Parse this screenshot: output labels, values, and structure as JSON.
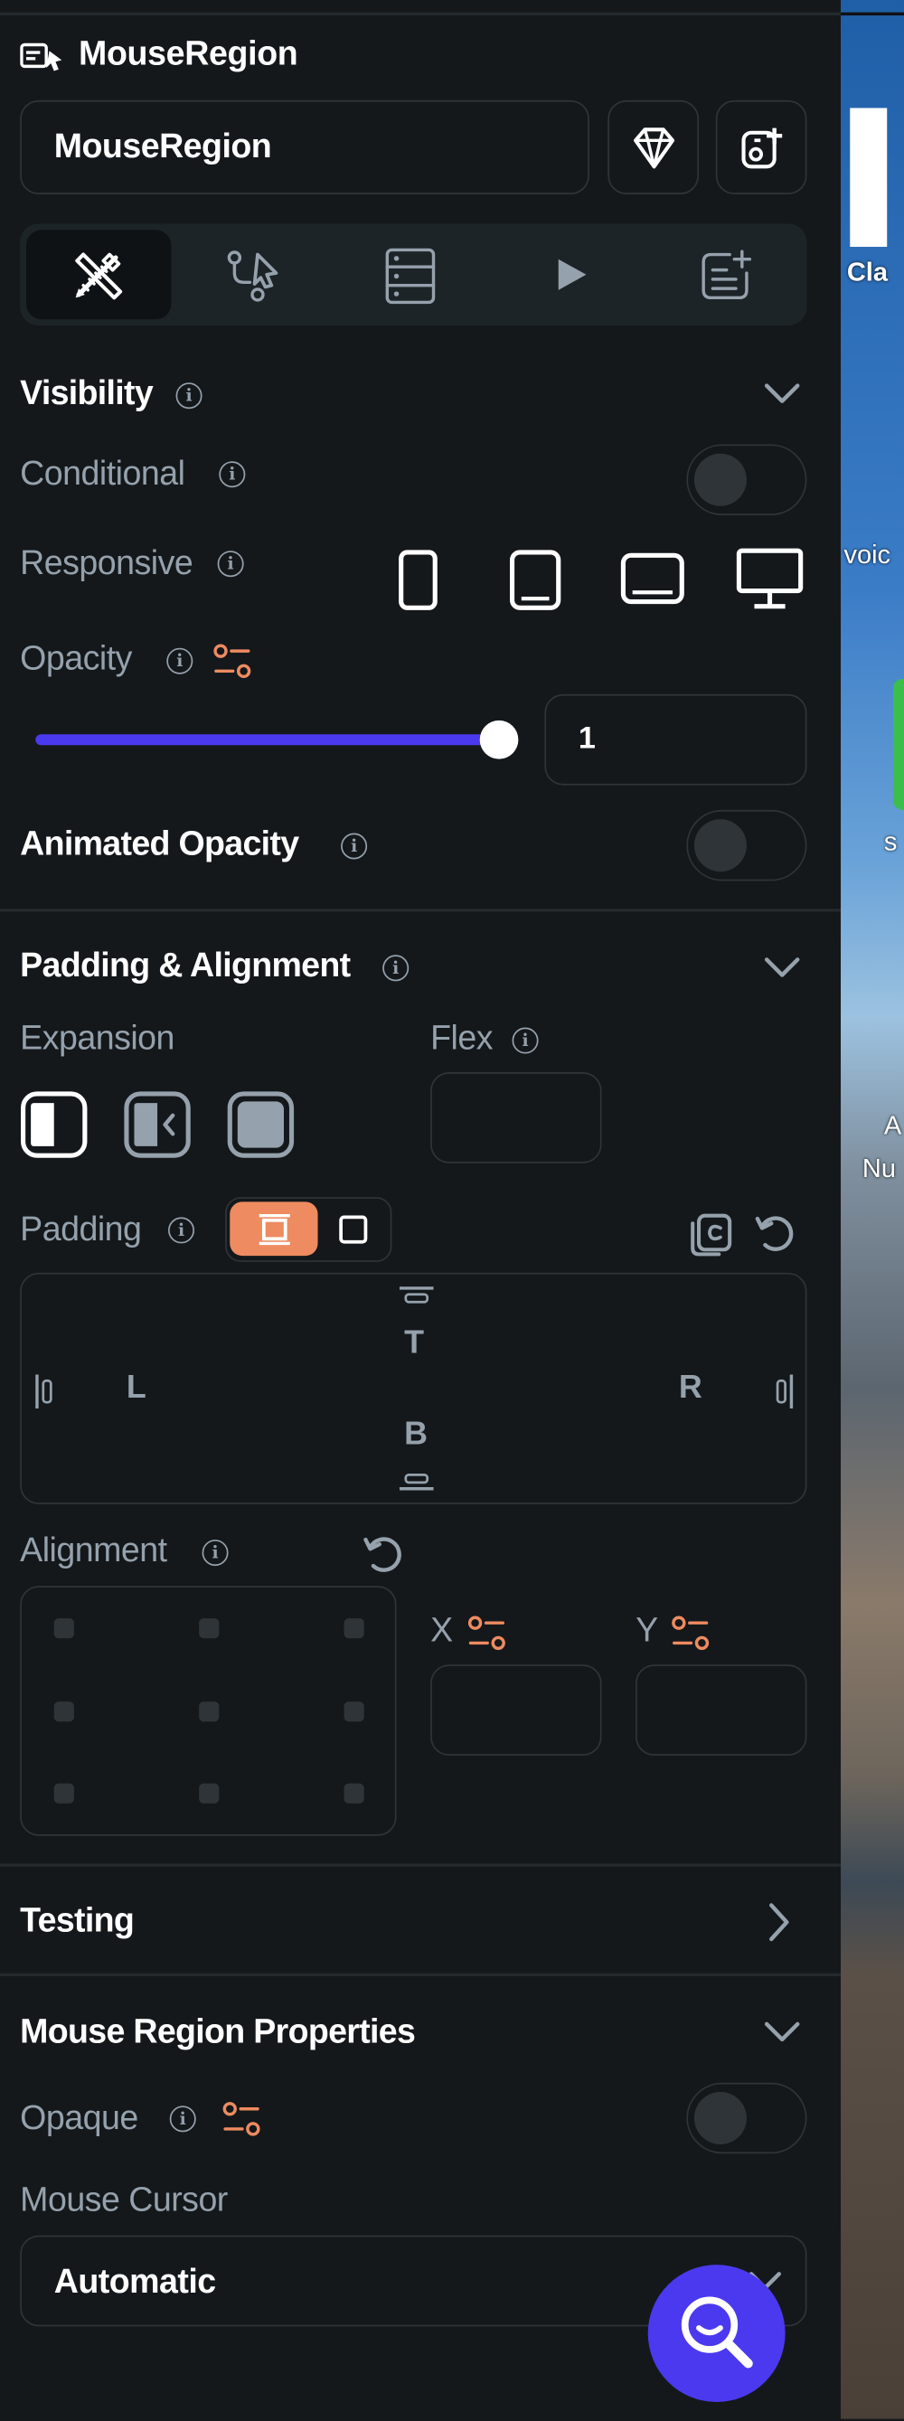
{
  "header": {
    "title": "MouseRegion",
    "name_value": "MouseRegion"
  },
  "tabs": [
    {
      "icon": "paint-palette-icon",
      "active": true
    },
    {
      "icon": "actions-flow-icon"
    },
    {
      "icon": "backend-query-icon"
    },
    {
      "icon": "play-icon"
    },
    {
      "icon": "add-document-icon"
    }
  ],
  "visibility": {
    "title": "Visibility",
    "conditional_label": "Conditional",
    "responsive_label": "Responsive",
    "opacity_label": "Opacity",
    "opacity_value": "1",
    "opacity_level": 1,
    "animated_opacity_label": "Animated Opacity"
  },
  "padding_alignment": {
    "title": "Padding & Alignment",
    "expansion_label": "Expansion",
    "flex_label": "Flex",
    "padding_label": "Padding",
    "pad_top": "T",
    "pad_left": "L",
    "pad_right": "R",
    "pad_bottom": "B",
    "alignment_label": "Alignment",
    "x_label": "X",
    "y_label": "Y"
  },
  "testing": {
    "title": "Testing"
  },
  "mouse_region": {
    "title": "Mouse Region Properties",
    "opaque_label": "Opaque",
    "mouse_cursor_label": "Mouse Cursor",
    "mouse_cursor_value": "Automatic"
  },
  "desktop_labels": [
    "Cla",
    "voic",
    "s",
    "A",
    "Nu"
  ],
  "colors": {
    "accent": "#4b39ef",
    "orange": "#ee8b60",
    "background": "#14181b",
    "border": "#2e3438",
    "secondary_text": "#95a1ac"
  }
}
